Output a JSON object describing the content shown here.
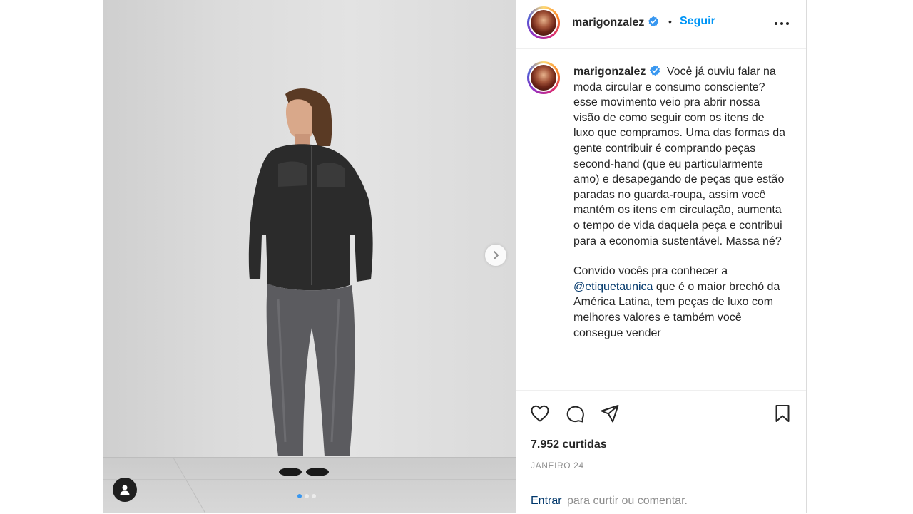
{
  "post": {
    "username": "marigonzalez",
    "header_separator": "•",
    "follow_label": "Seguir",
    "more_icon": "more-horizontal-icon",
    "verified_icon": "verified-badge-icon",
    "verified_color": "#3897f0"
  },
  "caption": {
    "username": "marigonzalez",
    "paragraph1": "Você já ouviu falar na moda circular e consumo consciente? esse movimento veio pra abrir nossa visão de como seguir com os itens de luxo que compramos. Uma das formas da gente contribuir é comprando peças second-hand (que eu particularmente amo) e desapegando de peças que estão paradas no guarda-roupa, assim você mantém os itens em circulação, aumenta o tempo de vida daquela peça e contribui para a economia sustentável. Massa né?",
    "paragraph2_start": "Convido vocês pra conhecer a",
    "mention": "@etiquetaunica",
    "paragraph2_end": "que é o maior brechó da América Latina, tem peças de luxo com melhores valores e também você consegue vender"
  },
  "media": {
    "carousel_total": 3,
    "carousel_active": 1,
    "next_icon": "chevron-right-icon",
    "tag_icon": "user-tag-icon",
    "active_dot_color": "#3897f0"
  },
  "actions": {
    "like_icon": "heart-icon",
    "comment_icon": "comment-icon",
    "share_icon": "send-icon",
    "save_icon": "bookmark-icon"
  },
  "stats": {
    "likes": "7.952 curtidas",
    "date": "JANEIRO 24"
  },
  "login_prompt": {
    "link": "Entrar",
    "text": "para curtir ou comentar."
  },
  "colors": {
    "accent": "#0095f6",
    "text": "#262626",
    "secondary": "#8e8e8e",
    "link": "#00376b"
  }
}
